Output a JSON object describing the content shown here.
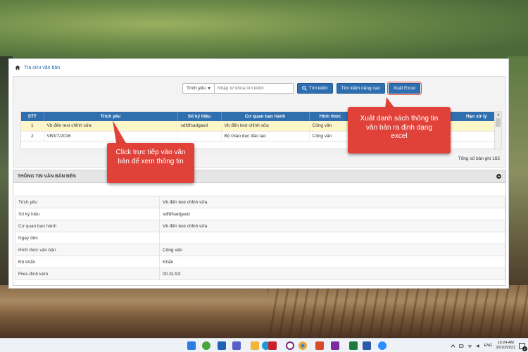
{
  "breadcrumb": {
    "label": "Tra cứu văn bản"
  },
  "search": {
    "field_dropdown": "Trích yếu",
    "placeholder": "Nhập từ khóa tìm kiếm",
    "search_button": "Tìm kiếm",
    "advanced_button": "Tìm kiếm nâng cao",
    "export_button": "Xuất Excel"
  },
  "grid": {
    "columns": [
      "STT",
      "Trích yếu",
      "Số ký hiệu",
      "Cơ quan ban hành",
      "Hình thức",
      "Hạn xử lý"
    ],
    "rows": [
      [
        "1",
        "Vb đến test chỉnh sửa",
        "sdfdfsadgasd",
        "Vb đến test chỉnh sửa",
        "Công văn",
        ""
      ],
      [
        "2",
        "VB3/7/2016",
        "",
        "Bộ Giáo dục đào tạo",
        "Công văn",
        ""
      ]
    ],
    "total_label": "Tổng số bản ghi 165"
  },
  "detail": {
    "title": "THÔNG TIN VĂN BẢN ĐẾN",
    "rows": [
      {
        "label": "Trích yếu",
        "value": "Vb đến test chỉnh sửa"
      },
      {
        "label": "Số ký hiệu",
        "value": "sdfdfsadgasd"
      },
      {
        "label": "Cơ quan ban hành",
        "value": "Vb đến test chỉnh sửa"
      },
      {
        "label": "Ngày đến",
        "value": ""
      },
      {
        "label": "Hình thức văn bản",
        "value": "Công văn"
      },
      {
        "label": "Độ khẩn",
        "value": "Khẩn"
      },
      {
        "label": "Files đính kèm",
        "value": "00.XLSX"
      }
    ]
  },
  "callouts": {
    "export_note": "Xuất danh sách thông tin văn bản ra định dạng excel",
    "click_note": "Click trực tiếp vào văn bản để xem thông tin"
  },
  "taskbar": {
    "language": "ENG",
    "time": "10:24 AM",
    "date": "20/10/2021",
    "notifications": "2"
  },
  "colors": {
    "primary": "#2f6fb0",
    "callout": "#e0423a",
    "selected_row": "#fdf6c8"
  }
}
